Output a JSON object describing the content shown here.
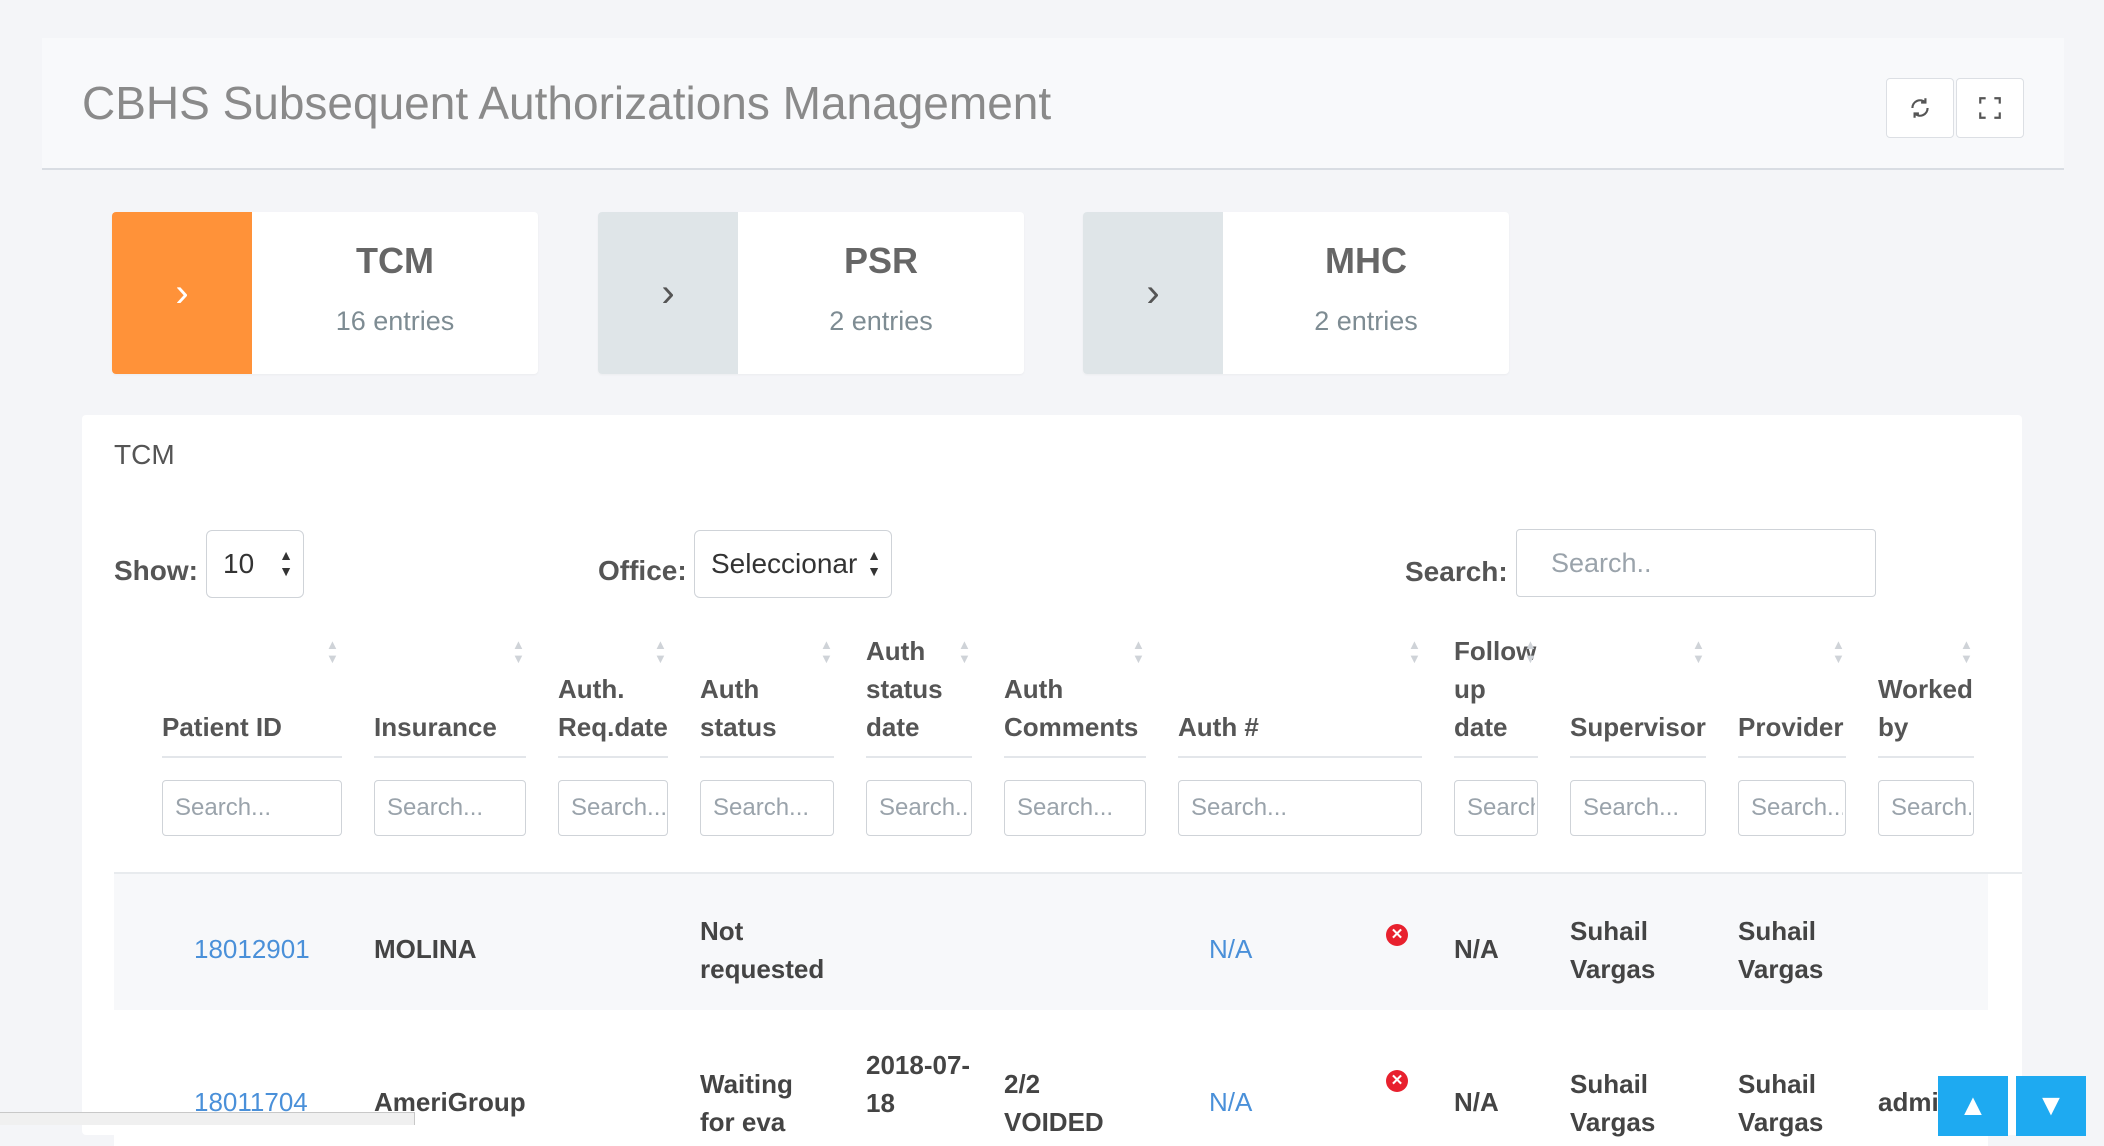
{
  "header": {
    "title": "CBHS Subsequent Authorizations Management",
    "refresh_icon": "refresh-icon",
    "fullscreen_icon": "fullscreen-icon"
  },
  "tiles": [
    {
      "name": "TCM",
      "count": "16 entries",
      "active": true,
      "color": "#ff9239"
    },
    {
      "name": "PSR",
      "count": "2 entries",
      "active": false,
      "color": "#dfe5e8"
    },
    {
      "name": "MHC",
      "count": "2 entries",
      "active": false,
      "color": "#dfe5e8"
    }
  ],
  "table_card": {
    "title": "TCM",
    "show_label": "Show:",
    "show_value": "10",
    "office_label": "Office:",
    "office_value": "Seleccionar",
    "search_label": "Search:",
    "search_placeholder": "Search.."
  },
  "columns": [
    {
      "label": "Patient ID",
      "placeholder": "Search..."
    },
    {
      "label": "Insurance",
      "placeholder": "Search..."
    },
    {
      "label": "Auth. Req.date",
      "placeholder": "Search..."
    },
    {
      "label": "Auth status",
      "placeholder": "Search..."
    },
    {
      "label": "Auth status date",
      "placeholder": "Search..."
    },
    {
      "label": "Auth Comments",
      "placeholder": "Search..."
    },
    {
      "label": "Auth #",
      "placeholder": "Search..."
    },
    {
      "label": "Follow up date",
      "placeholder": "Search..."
    },
    {
      "label": "Supervisor",
      "placeholder": "Search..."
    },
    {
      "label": "Provider",
      "placeholder": "Search..."
    },
    {
      "label": "Worked by",
      "placeholder": "Search..."
    }
  ],
  "rows": [
    {
      "patient_id": "18012901",
      "insurance": "MOLINA",
      "auth_req_date": "",
      "auth_status": "Not requested",
      "auth_status_date": "",
      "auth_comments": "",
      "auth_number": "N/A",
      "follow_up": "N/A",
      "supervisor": "Suhail Vargas",
      "provider": "Suhail Vargas",
      "worked_by": ""
    },
    {
      "patient_id": "18011704",
      "insurance": "AmeriGroup",
      "auth_req_date": "",
      "auth_status": "Waiting for eva",
      "auth_status_date": "2018-07-18",
      "auth_comments": "2/2 VOIDED",
      "auth_number": "N/A",
      "follow_up": "N/A",
      "supervisor": "Suhail Vargas",
      "provider": "Suhail Vargas",
      "worked_by": "admi"
    }
  ],
  "scroll": {
    "up": "▲",
    "down": "▼"
  }
}
